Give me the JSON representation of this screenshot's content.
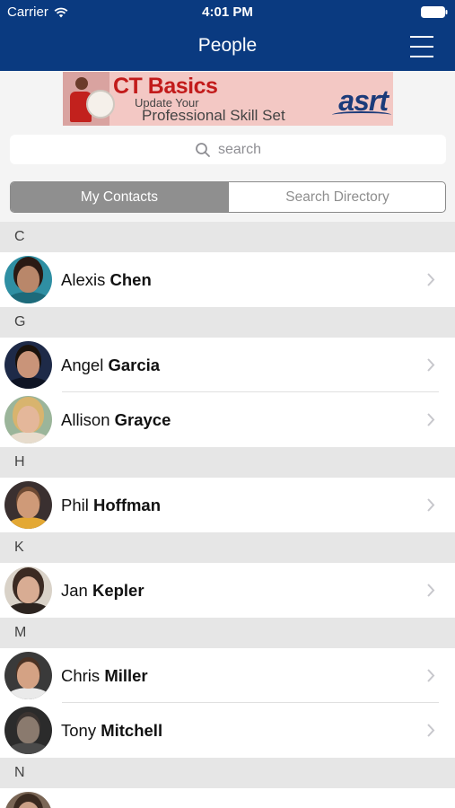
{
  "status_bar": {
    "carrier": "Carrier",
    "time": "4:01 PM"
  },
  "header": {
    "title": "People"
  },
  "banner": {
    "title": "CT Basics",
    "subtitle_line1": "Update Your",
    "subtitle_line2": "Professional Skill Set",
    "logo": "asrt"
  },
  "search": {
    "placeholder": "search"
  },
  "segments": {
    "active": "My Contacts",
    "inactive": "Search Directory"
  },
  "contacts": {
    "c_header": "C",
    "alexis_first": "Alexis",
    "alexis_last": "Chen",
    "g_header": "G",
    "angel_first": "Angel",
    "angel_last": "Garcia",
    "allison_first": "Allison",
    "allison_last": "Grayce",
    "h_header": "H",
    "phil_first": "Phil",
    "phil_last": "Hoffman",
    "k_header": "K",
    "jan_first": "Jan",
    "jan_last": "Kepler",
    "m_header": "M",
    "chris_first": "Chris",
    "chris_last": "Miller",
    "tony_first": "Tony",
    "tony_last": "Mitchell",
    "n_header": "N"
  },
  "colors": {
    "header_bg": "#0a3a80",
    "segment_active": "#8f8f8f",
    "section_bg": "#e6e6e6"
  },
  "icons": [
    "wifi-icon",
    "battery-icon",
    "menu-icon",
    "search-icon",
    "chevron-right-icon"
  ]
}
